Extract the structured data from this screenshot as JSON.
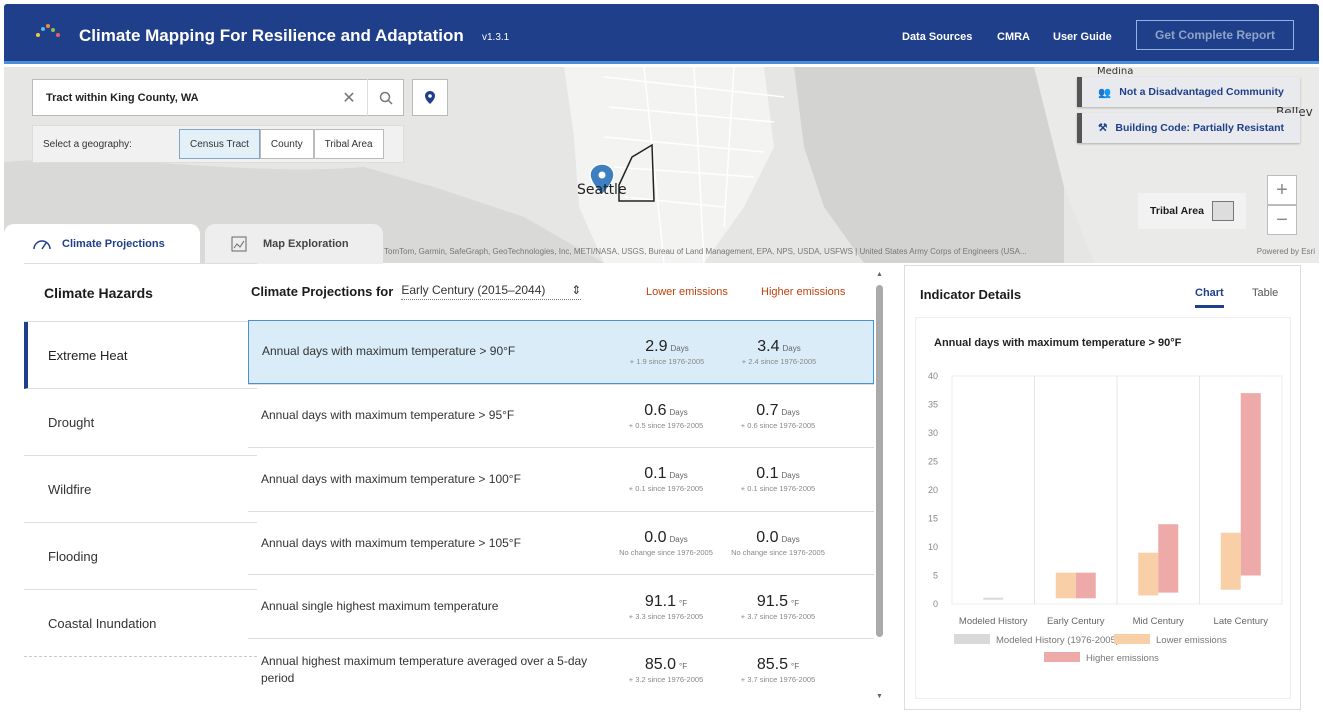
{
  "header": {
    "title": "Climate Mapping For Resilience and Adaptation",
    "version": "v1.3.1",
    "nav": [
      "Data Sources",
      "CMRA",
      "User Guide"
    ],
    "report_button": "Get Complete Report"
  },
  "map": {
    "search_value": "Tract within King County, WA",
    "geography_label": "Select a geography:",
    "geography_options": [
      "Census Tract",
      "County",
      "Tribal Area"
    ],
    "selected_geography": "Census Tract",
    "city_label": "Seattle",
    "place_labels": [
      "Medina",
      "Bellev"
    ],
    "badges": [
      "Not a Disadvantaged Community",
      "Building Code: Partially Resistant"
    ],
    "legend_label": "Tribal Area",
    "attribution": "TomTom, Garmin, SafeGraph, GeoTechnologies, Inc, METI/NASA, USGS, Bureau of Land Management, EPA, NPS, USDA, USFWS | United States Army Corps of Engineers (USA...",
    "powered_by": "Powered by Esri"
  },
  "tabs": [
    "Climate Projections",
    "Map Exploration"
  ],
  "hazards": {
    "title": "Climate Hazards",
    "items": [
      "Extreme Heat",
      "Drought",
      "Wildfire",
      "Flooding",
      "Coastal Inundation"
    ],
    "selected": "Extreme Heat"
  },
  "projections": {
    "title": "Climate Projections for",
    "period": "Early Century (2015–2044)",
    "lower_label": "Lower emissions",
    "higher_label": "Higher emissions",
    "rows": [
      {
        "label": "Annual days with maximum temperature > 90°F",
        "lower": "2.9",
        "lower_unit": "Days",
        "lower_change": "+ 1.9 since 1976-2005",
        "higher": "3.4",
        "higher_unit": "Days",
        "higher_change": "+ 2.4 since 1976-2005"
      },
      {
        "label": "Annual days with maximum temperature > 95°F",
        "lower": "0.6",
        "lower_unit": "Days",
        "lower_change": "+ 0.5 since 1976-2005",
        "higher": "0.7",
        "higher_unit": "Days",
        "higher_change": "+ 0.6 since 1976-2005"
      },
      {
        "label": "Annual days with maximum temperature > 100°F",
        "lower": "0.1",
        "lower_unit": "Days",
        "lower_change": "+ 0.1 since 1976-2005",
        "higher": "0.1",
        "higher_unit": "Days",
        "higher_change": "+ 0.1 since 1976-2005"
      },
      {
        "label": "Annual days with maximum temperature > 105°F",
        "lower": "0.0",
        "lower_unit": "Days",
        "lower_change": "No change since 1976-2005",
        "higher": "0.0",
        "higher_unit": "Days",
        "higher_change": "No change since 1976-2005"
      },
      {
        "label": "Annual single highest maximum temperature",
        "lower": "91.1",
        "lower_unit": "°F",
        "lower_change": "+ 3.3 since 1976-2005",
        "higher": "91.5",
        "higher_unit": "°F",
        "higher_change": "+ 3.7 since 1976-2005"
      },
      {
        "label": "Annual highest maximum temperature averaged over a 5-day period",
        "lower": "85.0",
        "lower_unit": "°F",
        "lower_change": "+ 3.2 since 1976-2005",
        "higher": "85.5",
        "higher_unit": "°F",
        "higher_change": "+ 3.7 since 1976-2005"
      }
    ]
  },
  "details": {
    "title": "Indicator Details",
    "tabs": [
      "Chart",
      "Table"
    ],
    "active_tab": "Chart"
  },
  "chart_data": {
    "type": "bar",
    "title": "Annual days with maximum temperature > 90°F",
    "categories": [
      "Modeled History",
      "Early Century",
      "Mid Century",
      "Late Century"
    ],
    "ylim": [
      0,
      40
    ],
    "yticks": [
      0,
      5,
      10,
      15,
      20,
      25,
      30,
      35,
      40
    ],
    "grid": "vertical",
    "legend_position": "bottom",
    "series": [
      {
        "name": "Modeled History (1976-2005)",
        "color": "#d9d9d9",
        "ranges": [
          [
            0.9,
            1.1
          ],
          null,
          null,
          null
        ]
      },
      {
        "name": "Lower emissions",
        "color": "#f9cfa8",
        "ranges": [
          null,
          [
            1,
            5.5
          ],
          [
            1.5,
            9
          ],
          [
            2.5,
            12.5
          ]
        ]
      },
      {
        "name": "Higher emissions",
        "color": "#eeaaa9",
        "ranges": [
          null,
          [
            1,
            5.5
          ],
          [
            2,
            14
          ],
          [
            5,
            37
          ]
        ]
      }
    ]
  }
}
